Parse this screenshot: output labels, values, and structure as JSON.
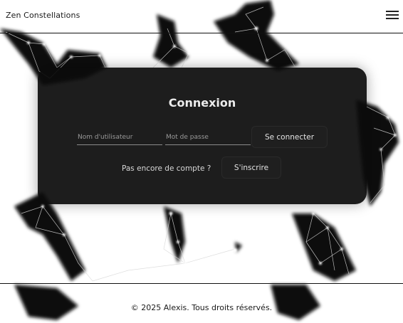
{
  "header": {
    "brand": "Zen Constellations",
    "menu_icon": "hamburger-menu-icon"
  },
  "login": {
    "title": "Connexion",
    "username_placeholder": "Nom d'utilisateur",
    "password_placeholder": "Mot de passe",
    "login_button": "Se connecter",
    "no_account_text": "Pas encore de compte ?",
    "signup_button": "S'inscrire"
  },
  "footer": {
    "copyright": "© 2025 Alexis. Tous droits réservés."
  },
  "colors": {
    "card_background": "#0c0c0c",
    "page_background": "#ffffff",
    "text_light": "#ececec"
  }
}
